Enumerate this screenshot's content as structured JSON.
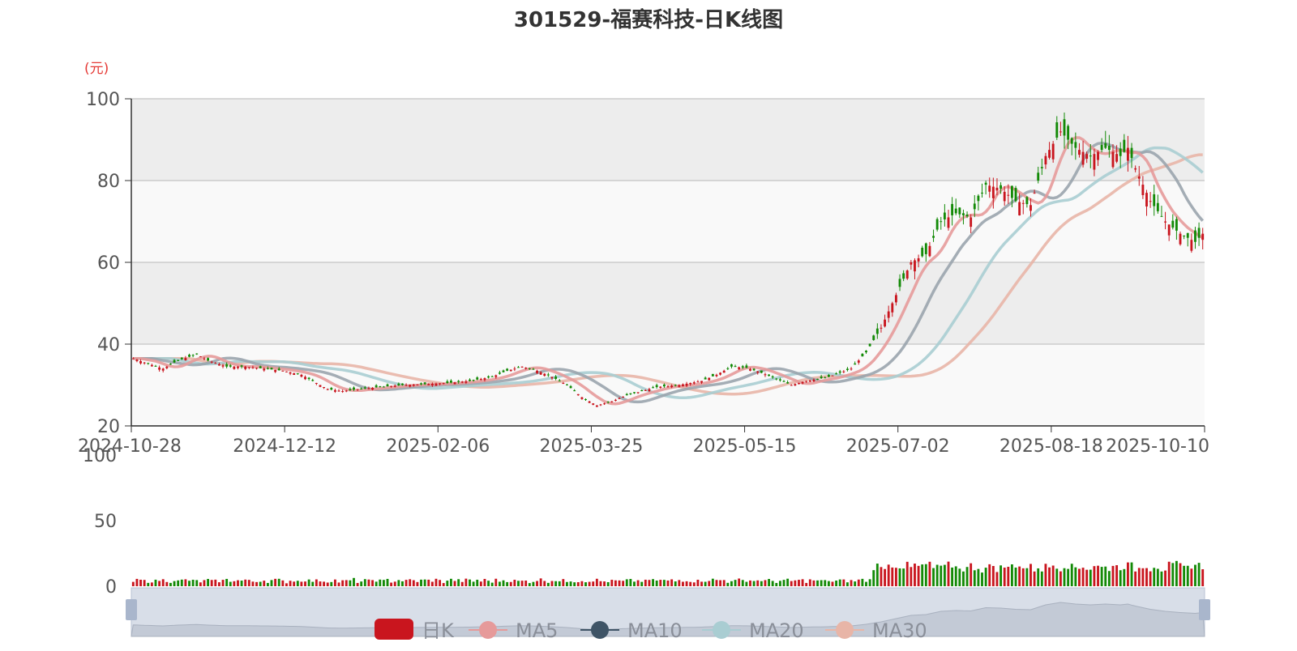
{
  "chart_data": {
    "type": "candlestick",
    "title": "301529-福赛科技-日K线图",
    "unit_label": "(元)",
    "colors": {
      "up": "#c9151e",
      "down": "#138a07",
      "ma5": "#e69a9a",
      "ma10": "#9aa4ad",
      "ma20": "#a9cdd2",
      "ma30": "#e8b5a7",
      "bg_band_dark": "#ededed",
      "bg_band_light": "#f9f9f9",
      "unit_color": "#e53935",
      "zoom_bg": "#d8dee8"
    },
    "price_axis": {
      "ylim": [
        20,
        100
      ],
      "ticks": [
        "20",
        "40",
        "60",
        "80",
        "100"
      ]
    },
    "volume_axis": {
      "ylim": [
        0,
        100
      ],
      "ticks": [
        "0",
        "50",
        "100"
      ]
    },
    "x_ticks": [
      "2024-10-28",
      "2024-12-12",
      "2025-02-06",
      "2025-03-25",
      "2025-05-15",
      "2025-07-02",
      "2025-08-18",
      "2025-10-10"
    ],
    "legend": [
      "日K",
      "MA5",
      "MA10",
      "MA20",
      "MA30"
    ],
    "close_anchors": [
      [
        0,
        36.5
      ],
      [
        3,
        35.5
      ],
      [
        8,
        34
      ],
      [
        12,
        36
      ],
      [
        17,
        37.5
      ],
      [
        20,
        36
      ],
      [
        25,
        34.5
      ],
      [
        30,
        34.5
      ],
      [
        35,
        34
      ],
      [
        40,
        33.5
      ],
      [
        45,
        32.5
      ],
      [
        48,
        31
      ],
      [
        52,
        29
      ],
      [
        56,
        28.5
      ],
      [
        60,
        29
      ],
      [
        66,
        29.5
      ],
      [
        72,
        30
      ],
      [
        78,
        30.2
      ],
      [
        84,
        30.5
      ],
      [
        90,
        31
      ],
      [
        96,
        32
      ],
      [
        100,
        33.5
      ],
      [
        104,
        34.5
      ],
      [
        108,
        33.5
      ],
      [
        112,
        32
      ],
      [
        116,
        30
      ],
      [
        120,
        27
      ],
      [
        124,
        25
      ],
      [
        128,
        26
      ],
      [
        132,
        27.5
      ],
      [
        136,
        28.5
      ],
      [
        140,
        29.5
      ],
      [
        146,
        30
      ],
      [
        152,
        31
      ],
      [
        156,
        32.5
      ],
      [
        160,
        34.5
      ],
      [
        164,
        34.2
      ],
      [
        168,
        33
      ],
      [
        172,
        31.5
      ],
      [
        176,
        30
      ],
      [
        180,
        31
      ],
      [
        186,
        32
      ],
      [
        192,
        34
      ],
      [
        196,
        38
      ],
      [
        200,
        44
      ],
      [
        204,
        52
      ],
      [
        208,
        60
      ],
      [
        212,
        62
      ],
      [
        216,
        70
      ],
      [
        220,
        72
      ],
      [
        224,
        71
      ],
      [
        228,
        79
      ],
      [
        232,
        78
      ],
      [
        236,
        75
      ],
      [
        240,
        74
      ],
      [
        244,
        86
      ],
      [
        248,
        92
      ],
      [
        252,
        88
      ],
      [
        256,
        86
      ],
      [
        260,
        88
      ],
      [
        264,
        86
      ],
      [
        266,
        88
      ],
      [
        268,
        83
      ],
      [
        272,
        75
      ],
      [
        276,
        70
      ],
      [
        280,
        67
      ],
      [
        284,
        65
      ],
      [
        286,
        67
      ]
    ]
  }
}
